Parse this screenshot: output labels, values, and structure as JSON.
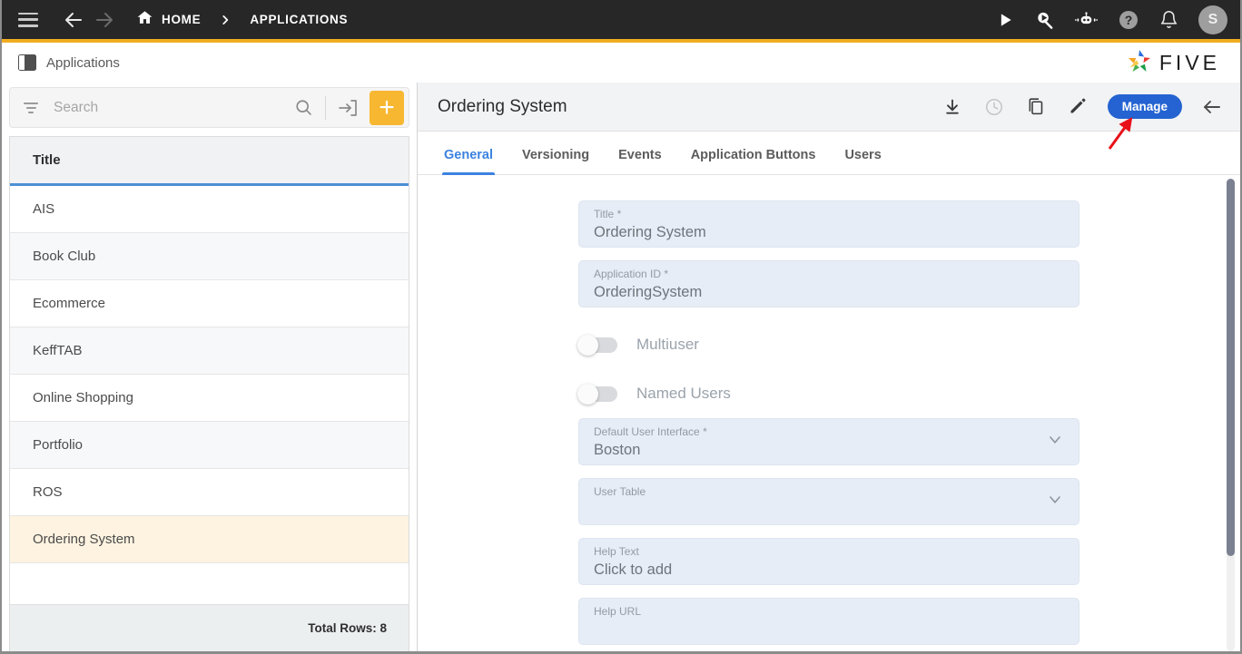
{
  "topbar": {
    "menu_icon": "hamburger-icon",
    "back_icon": "arrow-left-icon",
    "forward_icon": "arrow-right-icon",
    "home_icon": "home-icon",
    "breadcrumbs": [
      "HOME",
      "APPLICATIONS"
    ],
    "separator": "›",
    "actions": [
      "play-icon",
      "search-play-icon",
      "robot-icon",
      "help-icon",
      "bell-icon"
    ],
    "avatar_initial": "S",
    "accent_bar_color": "#f0ad22",
    "background_color": "#272727"
  },
  "subheader": {
    "tab_label": "Applications",
    "tab_icon": "panel-split-icon",
    "logo_text": "FIVE",
    "logo_icon": "five-pinwheel-icon"
  },
  "left_panel": {
    "search": {
      "placeholder": "Search",
      "value": "",
      "filter_icon": "filter-icon",
      "search_icon": "search-icon",
      "import_icon": "import-icon",
      "add_icon": "plus-icon",
      "add_button_color": "#f7b731"
    },
    "grid": {
      "column_header": "Title",
      "header_underline_color": "#4c8fd4",
      "rows": [
        {
          "title": "AIS",
          "selected": false
        },
        {
          "title": "Book Club",
          "selected": false
        },
        {
          "title": "Ecommerce",
          "selected": false
        },
        {
          "title": "KeffTAB",
          "selected": false
        },
        {
          "title": "Online Shopping",
          "selected": false
        },
        {
          "title": "Portfolio",
          "selected": false
        },
        {
          "title": "ROS",
          "selected": false
        },
        {
          "title": "Ordering System",
          "selected": true
        }
      ],
      "selected_row_color": "#fdf3e0",
      "footer_text": "Total Rows: 8"
    }
  },
  "right_panel": {
    "title": "Ordering System",
    "actions": [
      {
        "name": "download-icon",
        "disabled": false
      },
      {
        "name": "history-clock-icon",
        "disabled": true
      },
      {
        "name": "copy-icon",
        "disabled": false
      },
      {
        "name": "edit-pencil-icon",
        "disabled": false
      }
    ],
    "manage_label": "Manage",
    "manage_color": "#2463d1",
    "close_icon": "arrow-left-icon",
    "tabs": [
      {
        "label": "General",
        "active": true
      },
      {
        "label": "Versioning",
        "active": false
      },
      {
        "label": "Events",
        "active": false
      },
      {
        "label": "Application Buttons",
        "active": false
      },
      {
        "label": "Users",
        "active": false
      }
    ],
    "active_tab_color": "#3c82e0",
    "form": {
      "fields": [
        {
          "label": "Title",
          "required": true,
          "value": "Ordering System",
          "type": "text"
        },
        {
          "label": "Application ID",
          "required": true,
          "value": "OrderingSystem",
          "type": "text"
        },
        {
          "label": "Multiuser",
          "type": "toggle",
          "on": false
        },
        {
          "label": "Named Users",
          "type": "toggle",
          "on": false
        },
        {
          "label": "Default User Interface",
          "required": true,
          "value": "Boston",
          "type": "select"
        },
        {
          "label": "User Table",
          "required": false,
          "value": "",
          "type": "select"
        },
        {
          "label": "Help Text",
          "required": false,
          "value": "Click to add",
          "type": "text"
        },
        {
          "label": "Help URL",
          "required": false,
          "value": "",
          "type": "text"
        }
      ],
      "required_marker": "*",
      "field_bg_color": "#e6edf6"
    }
  },
  "annotation": {
    "arrow_color": "#e8111a",
    "points_at": "manage-button"
  }
}
